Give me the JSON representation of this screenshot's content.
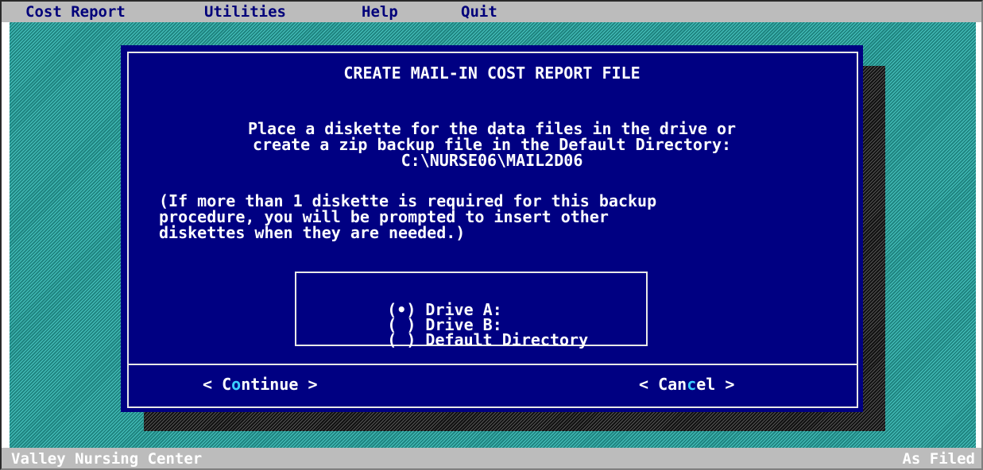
{
  "menubar": {
    "items": [
      {
        "label": "Cost Report"
      },
      {
        "label": "Utilities"
      },
      {
        "label": "Help"
      },
      {
        "label": "Quit"
      }
    ]
  },
  "dialog": {
    "title": "CREATE MAIL-IN COST REPORT FILE",
    "instructions": [
      "Place a diskette for the data files in the drive or",
      "create a zip backup file in the Default Directory:",
      "C:\\NURSE06\\MAIL2D06"
    ],
    "note": [
      "(If more than 1 diskette is required for this backup",
      "procedure, you will be prompted to insert other",
      "diskettes when they are needed.)"
    ],
    "options": [
      {
        "marker": "(•)",
        "label": "Drive A:",
        "selected": true
      },
      {
        "marker": "( )",
        "label": "Drive B:",
        "selected": false
      },
      {
        "marker": "( )",
        "label": "Default Directory",
        "selected": false
      }
    ],
    "buttons": {
      "continue": {
        "prefix": "< ",
        "pre": "C",
        "hot": "o",
        "post": "ntinue",
        "suffix": " >"
      },
      "cancel": {
        "prefix": "< ",
        "pre": "Can",
        "hot": "c",
        "post": "el",
        "suffix": " >"
      }
    }
  },
  "statusbar": {
    "left": "Valley Nursing Center",
    "right": "As Filed"
  },
  "colors": {
    "dialog_bg": "#000082",
    "desktop": "#2e9e9a",
    "menu_text": "#00007a",
    "hotkey": "#3ad0ff"
  }
}
